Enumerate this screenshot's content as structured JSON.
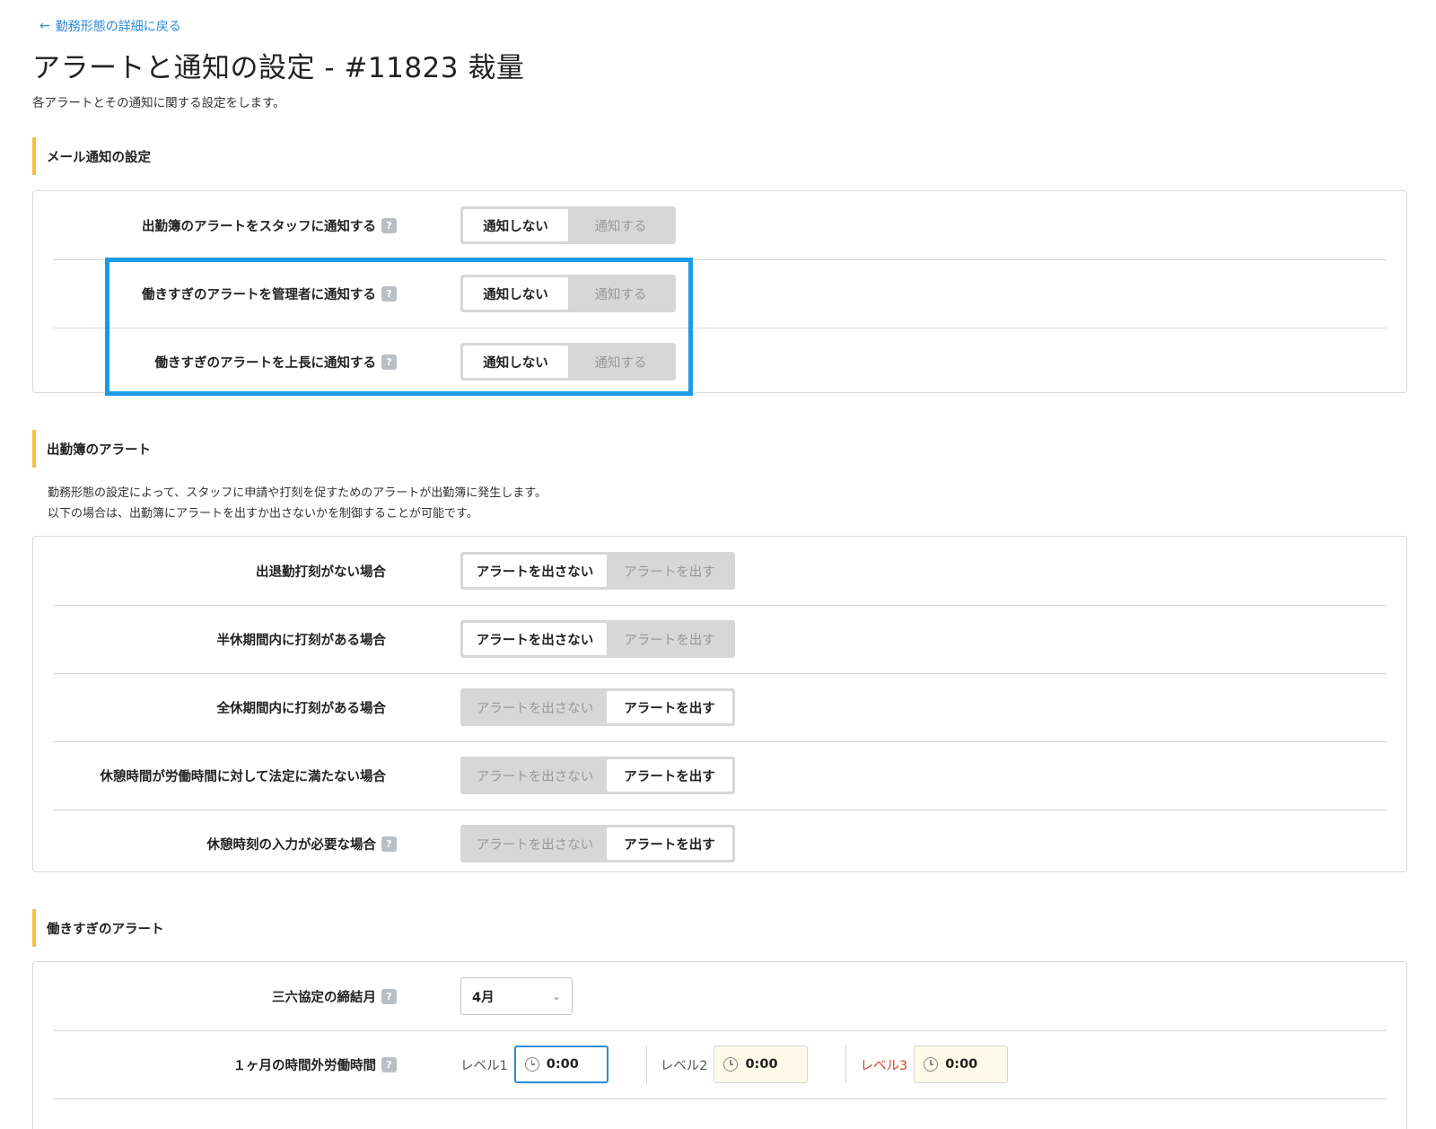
{
  "nav": {
    "back_label": "勤務形態の詳細に戻る"
  },
  "header": {
    "title": "アラートと通知の設定 - #11823 裁量",
    "description": "各アラートとその通知に関する設定をします。"
  },
  "email_section": {
    "title": "メール通知の設定",
    "rows": [
      {
        "label": "出勤簿のアラートをスタッフに通知する",
        "options": [
          "通知しない",
          "通知する"
        ],
        "selected": "通知しない"
      },
      {
        "label": "働きすぎのアラートを管理者に通知する",
        "options": [
          "通知しない",
          "通知する"
        ],
        "selected": "通知しない"
      },
      {
        "label": "働きすぎのアラートを上長に通知する",
        "options": [
          "通知しない",
          "通知する"
        ],
        "selected": "通知しない"
      }
    ]
  },
  "attendance_section": {
    "title": "出勤簿のアラート",
    "description_line1": "勤務形態の設定によって、スタッフに申請や打刻を促すためのアラートが出勤簿に発生します。",
    "description_line2": "以下の場合は、出勤簿にアラートを出すか出さないかを制御することが可能です。",
    "rows": [
      {
        "label": "出退勤打刻がない場合",
        "options": [
          "アラートを出さない",
          "アラートを出す"
        ],
        "selected": "アラートを出さない"
      },
      {
        "label": "半休期間内に打刻がある場合",
        "options": [
          "アラートを出さない",
          "アラートを出す"
        ],
        "selected": "アラートを出さない"
      },
      {
        "label": "全休期間内に打刻がある場合",
        "options": [
          "アラートを出さない",
          "アラートを出す"
        ],
        "selected": "アラートを出す"
      },
      {
        "label": "休憩時間が労働時間に対して法定に満たない場合",
        "options": [
          "アラートを出さない",
          "アラートを出す"
        ],
        "selected": "アラートを出す"
      },
      {
        "label": "休憩時刻の入力が必要な場合",
        "options": [
          "アラートを出さない",
          "アラートを出す"
        ],
        "selected": "アラートを出す"
      }
    ]
  },
  "overwork_section": {
    "title": "働きすぎのアラート",
    "closing_month": {
      "label": "三六協定の締結月",
      "value": "4月"
    },
    "monthly_overtime": {
      "label": "１ヶ月の時間外労働時間",
      "levels": [
        {
          "label": "レベル1",
          "value": "0:00"
        },
        {
          "label": "レベル2",
          "value": "0:00"
        },
        {
          "label": "レベル3",
          "value": "0:00"
        }
      ]
    }
  },
  "colors": {
    "accent": "#2b8ad8",
    "section_marker": "#f5c141",
    "highlight": "#1a9be6",
    "level3": "#d0452b"
  },
  "icons": {
    "help": "?",
    "back_arrow": "←",
    "chevron": "⌄"
  }
}
